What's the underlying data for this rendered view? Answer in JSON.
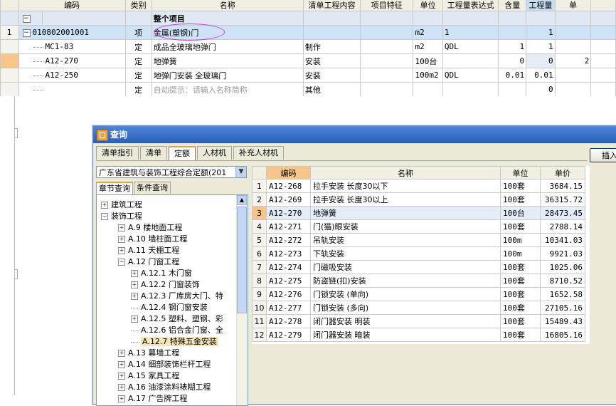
{
  "bill_table": {
    "headers": [
      "编码",
      "类别",
      "名称",
      "清单工程内容",
      "项目特征",
      "单位",
      "工程量表达式",
      "含量",
      "工程量",
      "单"
    ],
    "section_label": "整个项目",
    "rows": [
      {
        "no": "1",
        "code": "010802001001",
        "type": "项",
        "name": "金属(塑钢)门",
        "content": "",
        "feature": "",
        "unit": "m2",
        "expr": "1",
        "ratio": "",
        "qty": "1",
        "extra": ""
      },
      {
        "no": "",
        "code": "MC1-83",
        "type": "定",
        "name": "成品全玻璃地弹门",
        "content": "制作",
        "feature": "",
        "unit": "m2",
        "expr": "QDL",
        "ratio": "1",
        "qty": "1",
        "extra": ""
      },
      {
        "no": "",
        "code": "A12-270",
        "type": "定",
        "name": "地弹簧",
        "content": "安装",
        "feature": "",
        "unit": "100台",
        "expr": "",
        "ratio": "0",
        "qty": "0",
        "extra": "2"
      },
      {
        "no": "",
        "code": "A12-250",
        "type": "定",
        "name": "地弹门安装 全玻璃门",
        "content": "安装",
        "feature": "",
        "unit": "100m2",
        "expr": "QDL",
        "ratio": "0.01",
        "qty": "0.01",
        "extra": ""
      },
      {
        "no": "",
        "code": "",
        "type": "定",
        "name": "自动提示：请输入名称简称",
        "content": "其他",
        "feature": "",
        "unit": "",
        "expr": "",
        "ratio": "",
        "qty": "0",
        "extra": ""
      }
    ]
  },
  "dialog": {
    "title": "查询",
    "tabs": [
      "清单指引",
      "清单",
      "定额",
      "人材机",
      "补充人材机"
    ],
    "insert_label": "插入",
    "quota_library": "广东省建筑与装饰工程综合定额(201",
    "subtabs": [
      "章节查询",
      "条件查询"
    ],
    "tree": [
      {
        "label": "建筑工程",
        "level": 0,
        "toggle": "+"
      },
      {
        "label": "装饰工程",
        "level": 0,
        "toggle": "-"
      },
      {
        "label": "A.9 楼地面工程",
        "level": 1,
        "toggle": "+"
      },
      {
        "label": "A.10 墙柱面工程",
        "level": 1,
        "toggle": "+"
      },
      {
        "label": "A.11 天棚工程",
        "level": 1,
        "toggle": "+"
      },
      {
        "label": "A.12 门窗工程",
        "level": 1,
        "toggle": "-"
      },
      {
        "label": "A.12.1 木门窗",
        "level": 2,
        "toggle": "+"
      },
      {
        "label": "A.12.2 门窗装饰",
        "level": 2,
        "toggle": "+"
      },
      {
        "label": "A.12.3 厂库房大门、特",
        "level": 2,
        "toggle": "+"
      },
      {
        "label": "A.12.4 钢门窗安装",
        "level": 2,
        "toggle": ""
      },
      {
        "label": "A.12.5 塑料、塑钢、彩",
        "level": 2,
        "toggle": "+"
      },
      {
        "label": "A.12.6 铝合金门窗、全",
        "level": 2,
        "toggle": ""
      },
      {
        "label": "A.12.7 特殊五金安装",
        "level": 2,
        "toggle": "",
        "selected": true
      },
      {
        "label": "A.13 幕墙工程",
        "level": 1,
        "toggle": "+"
      },
      {
        "label": "A.14 细部装饰栏杆工程",
        "level": 1,
        "toggle": "+"
      },
      {
        "label": "A.15 家具工程",
        "level": 1,
        "toggle": "+"
      },
      {
        "label": "A.16 油漆涂料裱糊工程",
        "level": 1,
        "toggle": "+"
      },
      {
        "label": "A.17 广告牌工程",
        "level": 1,
        "toggle": "+"
      }
    ],
    "quota_headers": [
      "编码",
      "名称",
      "单位",
      "单价"
    ],
    "quota_rows": [
      {
        "no": "1",
        "code": "A12-268",
        "name": "拉手安装 长度30以下",
        "unit": "100套",
        "price": "3684.15"
      },
      {
        "no": "2",
        "code": "A12-269",
        "name": "拉手安装 长度30以上",
        "unit": "100套",
        "price": "36315.72"
      },
      {
        "no": "3",
        "code": "A12-270",
        "name": "地弹簧",
        "unit": "100台",
        "price": "28473.45"
      },
      {
        "no": "4",
        "code": "A12-271",
        "name": "门(猫)眼安装",
        "unit": "100套",
        "price": "2788.14"
      },
      {
        "no": "5",
        "code": "A12-272",
        "name": "吊轨安装",
        "unit": "100m",
        "price": "10341.03"
      },
      {
        "no": "6",
        "code": "A12-273",
        "name": "下轨安装",
        "unit": "100m",
        "price": "9921.03"
      },
      {
        "no": "7",
        "code": "A12-274",
        "name": "门磁吸安装",
        "unit": "100套",
        "price": "1025.06"
      },
      {
        "no": "8",
        "code": "A12-275",
        "name": "防盗链(扣)安装",
        "unit": "100套",
        "price": "8710.52"
      },
      {
        "no": "9",
        "code": "A12-276",
        "name": "门锁安装 (单向)",
        "unit": "100套",
        "price": "1652.58"
      },
      {
        "no": "10",
        "code": "A12-277",
        "name": "门锁安装 (多向)",
        "unit": "100套",
        "price": "27105.16"
      },
      {
        "no": "11",
        "code": "A12-278",
        "name": "闭门器安装 明装",
        "unit": "100套",
        "price": "15489.43"
      },
      {
        "no": "12",
        "code": "A12-279",
        "name": "闭门器安装 暗装",
        "unit": "100套",
        "price": "16805.16"
      }
    ]
  }
}
